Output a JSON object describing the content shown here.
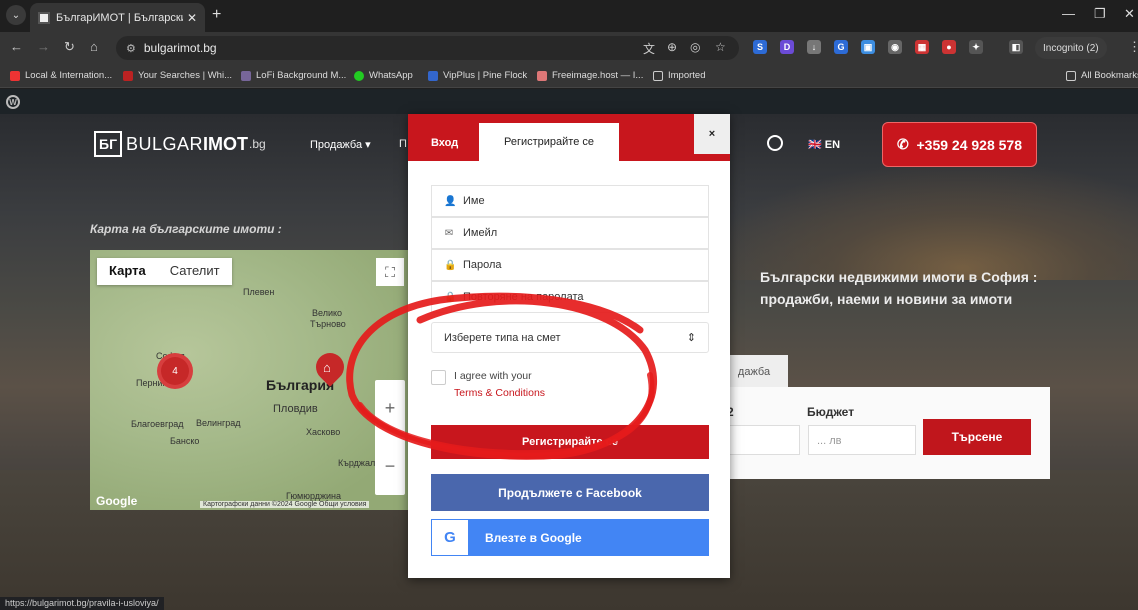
{
  "browser": {
    "tab_title": "БългарИМОТ | Български недв",
    "url": "bulgarimot.bg",
    "incognito": "Incognito (2)",
    "bookmarks": [
      "Local & Internation...",
      "Your Searches | Whi...",
      "LoFi Background M...",
      "WhatsApp",
      "VipPlus | Pine Flock",
      "Freeimage.host — I...",
      "Imported"
    ],
    "all_bookmarks": "All Bookmarks",
    "status_url": "https://bulgarimot.bg/pravila-i-usloviya/"
  },
  "site": {
    "logo_a": "BULGAR",
    "logo_b": "IMOT",
    "logo_c": ".bg",
    "nav_sale": "Продажба ▾",
    "nav_partial": "П",
    "lang": "EN",
    "phone": "+359 24 928 578",
    "map_label": "Карта на българските имоти :",
    "map_tab_map": "Карта",
    "map_tab_sat": "Сателит",
    "map_cluster": "4",
    "map_labels": [
      "Плевен",
      "Велико",
      "Търново",
      "София",
      "Перник",
      "България",
      "Пловдив",
      "Благоевград",
      "Велинград",
      "Банско",
      "Хасково",
      "Кърджали",
      "Гюмюрджина"
    ],
    "map_copy": "Картографски данни ©2024 Google   Общи условия",
    "google": "Google",
    "hero_title": "Български недвижими имоти в София : продажби, наеми и новини за имоти",
    "tab_partial": "дажба",
    "budget_label": "Бюджет",
    "budget_placeholder": "... лв",
    "n2": "2",
    "search": "Търсене"
  },
  "modal": {
    "tab_login": "Вход",
    "tab_register": "Регистрирайте се",
    "close": "×",
    "fields": [
      "Име",
      "Имейл",
      "Парола",
      "Повторяне на паролата"
    ],
    "select": "Изберете типа на смет",
    "agree": "I agree with your",
    "terms": "Terms & Conditions",
    "register_btn": "Регистрирайте се",
    "facebook": "Продължете с Facebook",
    "google": "Влезте в Google"
  },
  "colors": {
    "brand_red": "#c8161d",
    "facebook": "#4a67ad",
    "google": "#4285f4"
  }
}
